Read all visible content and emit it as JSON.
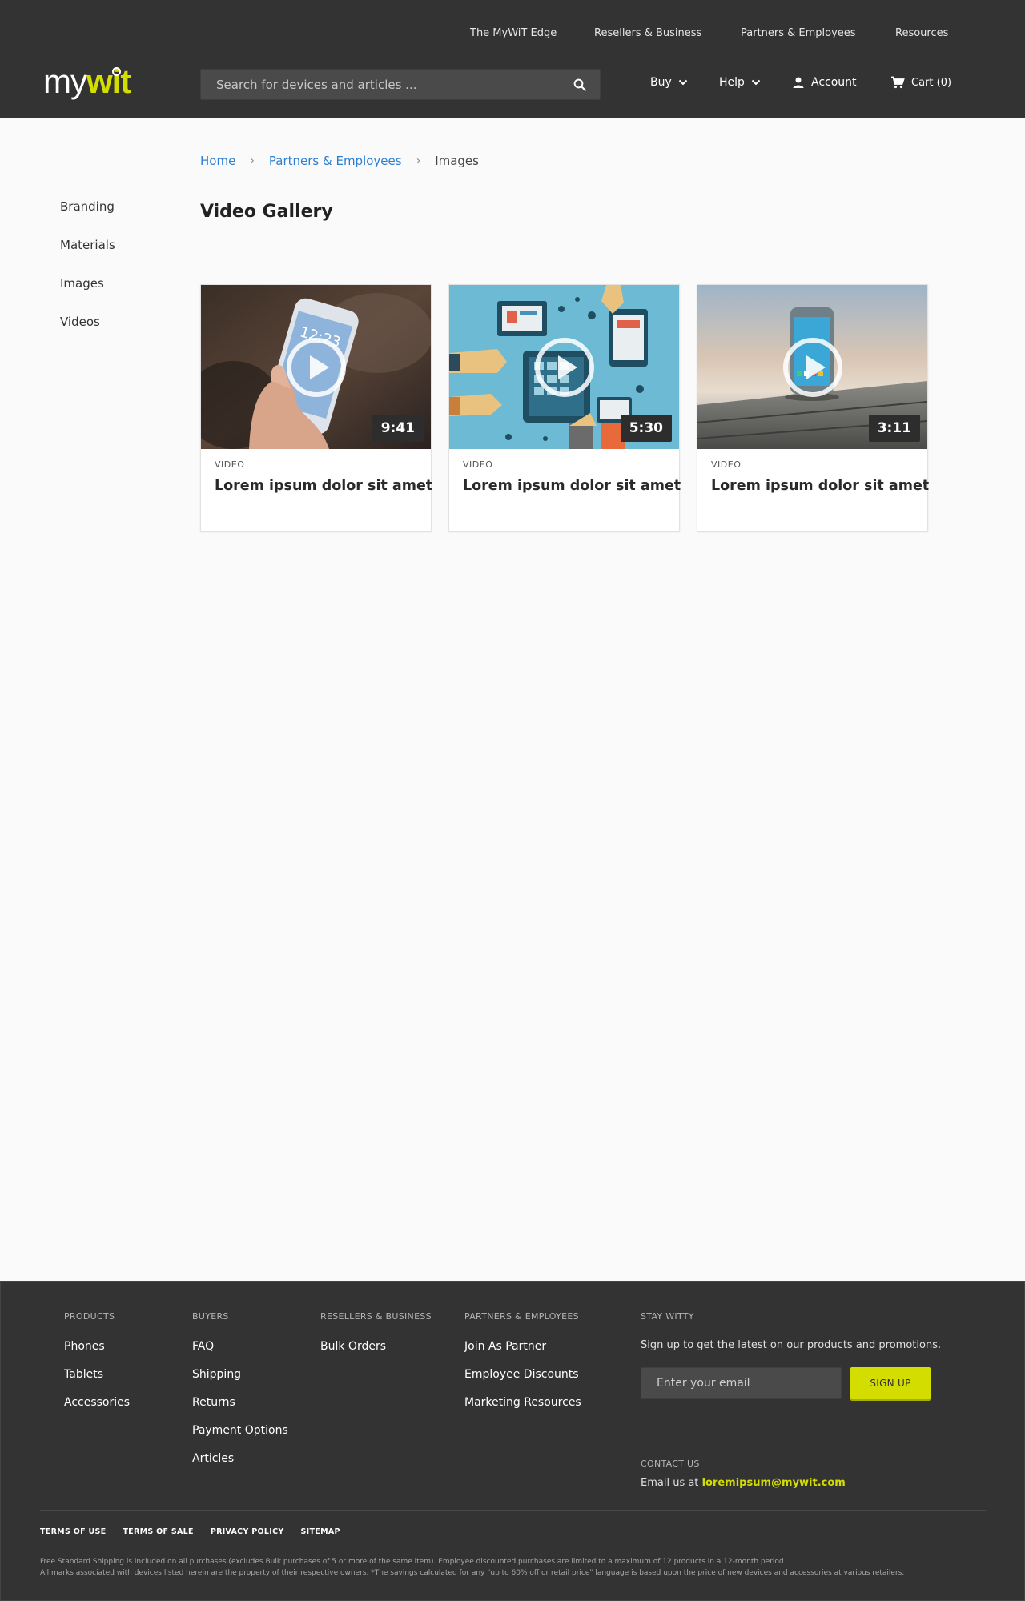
{
  "header": {
    "logo": {
      "my": "my",
      "wit": "wit"
    },
    "top_links": [
      "The MyWiT Edge",
      "Resellers & Business",
      "Partners & Employees",
      "Resources"
    ],
    "search": {
      "placeholder": "Search for devices and articles ..."
    },
    "nav": {
      "buy": "Buy",
      "help": "Help",
      "account": "Account",
      "cart": "Cart (0)"
    }
  },
  "sidebar": {
    "items": [
      {
        "label": "Branding"
      },
      {
        "label": "Materials"
      },
      {
        "label": "Images"
      },
      {
        "label": "Videos"
      }
    ]
  },
  "breadcrumb": {
    "home": "Home",
    "section": "Partners & Employees",
    "current": "Images"
  },
  "main": {
    "title": "Video Gallery",
    "cards": [
      {
        "kind": "VIDEO",
        "title": "Lorem ipsum dolor sit amet",
        "duration": "9:41"
      },
      {
        "kind": "VIDEO",
        "title": "Lorem ipsum dolor sit amet",
        "duration": "5:30"
      },
      {
        "kind": "VIDEO",
        "title": "Lorem ipsum dolor sit amet",
        "duration": "3:11"
      }
    ]
  },
  "footer": {
    "columns": [
      {
        "heading": "PRODUCTS",
        "links": [
          "Phones",
          "Tablets",
          "Accessories"
        ]
      },
      {
        "heading": "BUYERS",
        "links": [
          "FAQ",
          "Shipping",
          "Returns",
          "Payment Options",
          "Articles"
        ]
      },
      {
        "heading": "RESELLERS & BUSINESS",
        "links": [
          "Bulk Orders"
        ]
      },
      {
        "heading": "PARTNERS & EMPLOYEES",
        "links": [
          "Join As Partner",
          "Employee Discounts",
          "Marketing Resources"
        ]
      }
    ],
    "stay_witty": {
      "heading": "STAY WITTY",
      "description": "Sign up to get the latest on our products and promotions.",
      "email_placeholder": "Enter your email",
      "button": "SIGN UP"
    },
    "contact": {
      "heading": "CONTACT US",
      "prefix": "Email us at",
      "email": "loremipsum@mywit.com"
    },
    "legal_links": [
      "TERMS OF USE",
      "TERMS OF SALE",
      "PRIVACY POLICY",
      "SITEMAP"
    ],
    "fine_print": [
      "Free Standard Shipping is included on all purchases (excludes Bulk purchases of 5 or more of the same item). Employee discounted purchases are limited to a maximum of 12 products in a 12-month period.",
      "All marks associated with devices listed herein are the property of their respective owners. *The savings calculated for any \"up to 60% off or retail price\" language is based upon the price of new devices and accessories at various retailers."
    ]
  },
  "colors": {
    "header_bg": "#333333",
    "accent": "#d4dd00",
    "link": "#2d7fd3",
    "page_bg": "#fafafa"
  }
}
